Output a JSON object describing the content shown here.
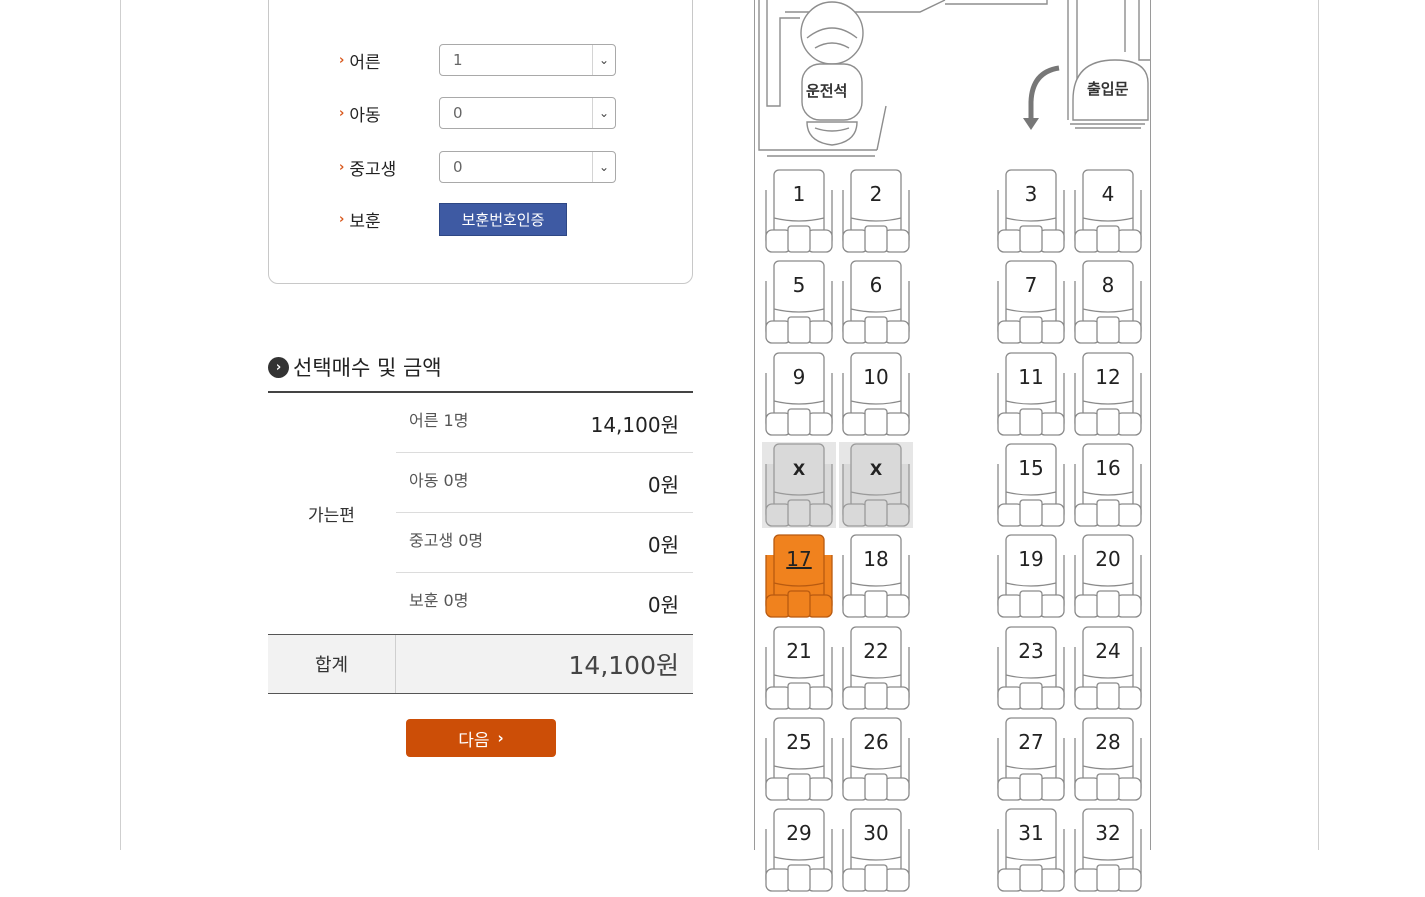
{
  "passengers": {
    "adult": {
      "label": "어른",
      "value": "1"
    },
    "child": {
      "label": "아동",
      "value": "0"
    },
    "student": {
      "label": "중고생",
      "value": "0"
    },
    "veteran": {
      "label": "보훈",
      "button": "보훈번호인증"
    }
  },
  "summary": {
    "title": "선택매수 및 금액",
    "trip_label": "가는편",
    "rows": [
      {
        "label": "어른 1명",
        "amount": "14,100원"
      },
      {
        "label": "아동 0명",
        "amount": "0원"
      },
      {
        "label": "중고생 0명",
        "amount": "0원"
      },
      {
        "label": "보훈 0명",
        "amount": "0원"
      }
    ],
    "total_label": "합계",
    "total_amount": "14,100원"
  },
  "next_button": "다음",
  "bus": {
    "driver_label": "운전석",
    "door_label": "출입문",
    "seats": [
      {
        "label": "1",
        "status": "available"
      },
      {
        "label": "2",
        "status": "available"
      },
      {
        "label": "3",
        "status": "available"
      },
      {
        "label": "4",
        "status": "available"
      },
      {
        "label": "5",
        "status": "available"
      },
      {
        "label": "6",
        "status": "available"
      },
      {
        "label": "7",
        "status": "available"
      },
      {
        "label": "8",
        "status": "available"
      },
      {
        "label": "9",
        "status": "available"
      },
      {
        "label": "10",
        "status": "available"
      },
      {
        "label": "11",
        "status": "available"
      },
      {
        "label": "12",
        "status": "available"
      },
      {
        "label": "X",
        "status": "sold"
      },
      {
        "label": "X",
        "status": "sold"
      },
      {
        "label": "15",
        "status": "available"
      },
      {
        "label": "16",
        "status": "available"
      },
      {
        "label": "17",
        "status": "selected"
      },
      {
        "label": "18",
        "status": "available"
      },
      {
        "label": "19",
        "status": "available"
      },
      {
        "label": "20",
        "status": "available"
      },
      {
        "label": "21",
        "status": "available"
      },
      {
        "label": "22",
        "status": "available"
      },
      {
        "label": "23",
        "status": "available"
      },
      {
        "label": "24",
        "status": "available"
      },
      {
        "label": "25",
        "status": "available"
      },
      {
        "label": "26",
        "status": "available"
      },
      {
        "label": "27",
        "status": "available"
      },
      {
        "label": "28",
        "status": "available"
      },
      {
        "label": "29",
        "status": "available"
      },
      {
        "label": "30",
        "status": "available"
      },
      {
        "label": "31",
        "status": "available"
      },
      {
        "label": "32",
        "status": "available"
      }
    ]
  },
  "colors": {
    "accent": "#cc4e07",
    "selected_seat": "#f0821e",
    "sold_seat": "#d9d9d9",
    "verify_button": "#3e5aa3"
  }
}
